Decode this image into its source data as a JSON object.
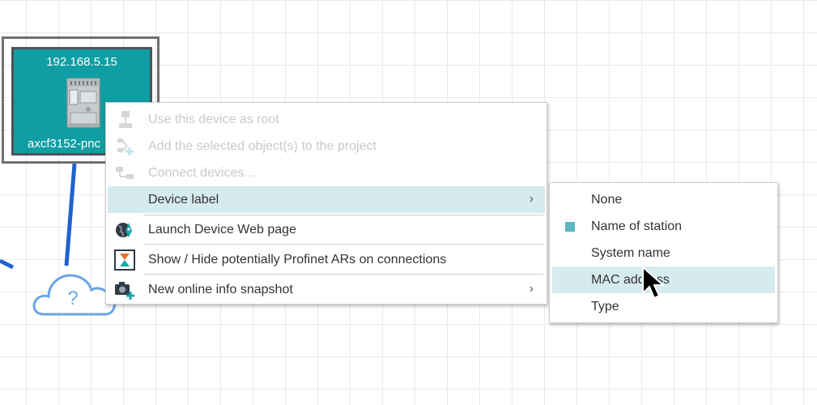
{
  "device": {
    "ip": "192.168.5.15",
    "name": "axcf3152-pnc"
  },
  "cloud": {
    "symbol": "?"
  },
  "context_menu": {
    "items": [
      {
        "label": "Use this device as root",
        "icon": "root-device-icon",
        "disabled": true
      },
      {
        "label": "Add the selected object(s) to the project",
        "icon": "add-to-project-icon",
        "disabled": true
      },
      {
        "label": "Connect devices...",
        "icon": "connect-devices-icon",
        "disabled": true
      },
      {
        "label": "Device label",
        "icon": "",
        "has_submenu": true,
        "highlighted": true
      },
      {
        "label": "Launch Device Web page",
        "icon": "globe-rocket-icon"
      },
      {
        "label": "Show / Hide potentially Profinet ARs on connections",
        "icon": "hourglass-icon"
      },
      {
        "label": "New online info snapshot",
        "icon": "camera-add-icon",
        "has_submenu": true
      }
    ],
    "submenu_arrow": "›"
  },
  "device_label_submenu": {
    "items": [
      {
        "label": "None",
        "checked": false
      },
      {
        "label": "Name of station",
        "checked": true
      },
      {
        "label": "System name",
        "checked": false
      },
      {
        "label": "MAC address",
        "checked": false,
        "highlighted": true
      },
      {
        "label": "Type",
        "checked": false
      }
    ]
  },
  "colors": {
    "device_tile": "#0f9ea3",
    "highlight": "#d5ebee",
    "check_marker": "#5bb8c4",
    "link_line": "#1e63cf",
    "cloud_outline": "#6aa5e6"
  }
}
